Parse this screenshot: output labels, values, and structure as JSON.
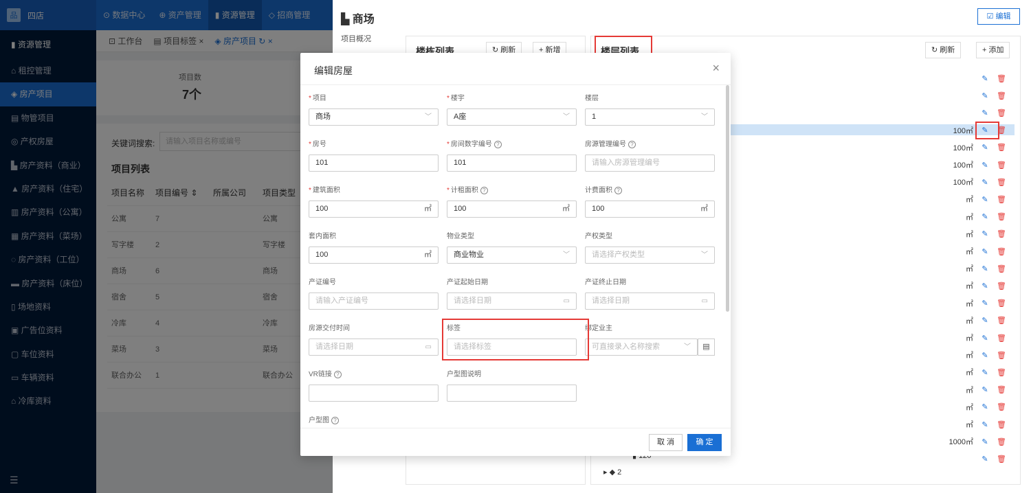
{
  "app": {
    "logo_text": "四店",
    "logo_glyph": "品"
  },
  "topnav": [
    {
      "label": "⊙ 数据中心"
    },
    {
      "label": "⊕ 资产管理"
    },
    {
      "label": "▮ 资源管理"
    },
    {
      "label": "◇ 招商管理"
    }
  ],
  "sidebar": {
    "items": [
      {
        "label": "▮ 资源管理"
      },
      {
        "label": "⌂ 租控管理"
      },
      {
        "label": "◈ 房产项目"
      },
      {
        "label": "▤ 物管项目"
      },
      {
        "label": "◎ 产权房屋"
      },
      {
        "label": "▙ 房产资料（商业）"
      },
      {
        "label": "▲ 房产资料（住宅）"
      },
      {
        "label": "▥ 房产资料（公寓）"
      },
      {
        "label": "▦ 房产资料（菜场）"
      },
      {
        "label": "◌ 房产资料（工位）"
      },
      {
        "label": "▬ 房产资料（床位）"
      },
      {
        "label": "▯ 场地资料"
      },
      {
        "label": "▣ 广告位资料"
      },
      {
        "label": "▢ 车位资料"
      },
      {
        "label": "▭ 车辆资料"
      },
      {
        "label": "⌂ 冷库资料"
      }
    ],
    "footer_icon": "☰"
  },
  "tabs": [
    {
      "label": "⊡ 工作台"
    },
    {
      "label": "▤ 项目标签 ×"
    },
    {
      "label": "◈ 房产项目 ↻ ×"
    }
  ],
  "stats": {
    "label": "项目数",
    "value": "7个"
  },
  "search": {
    "label": "关键词搜索:",
    "placeholder": "请输入项目名称或编号"
  },
  "project_list": {
    "title": "项目列表",
    "headers": [
      "项目名称",
      "项目编号  ⇕",
      "所属公司",
      "项目类型"
    ],
    "rows": [
      [
        "公寓",
        "7",
        "",
        "公寓"
      ],
      [
        "写字楼",
        "2",
        "",
        "写字楼"
      ],
      [
        "商场",
        "6",
        "",
        "商场"
      ],
      [
        "宿舍",
        "5",
        "",
        "宿舍"
      ],
      [
        "冷库",
        "4",
        "",
        "冷库"
      ],
      [
        "菜场",
        "3",
        "",
        "菜场"
      ],
      [
        "联合办公",
        "1",
        "",
        "联合办公"
      ]
    ]
  },
  "drawer": {
    "title": "▙ 商场",
    "edit_label": "☑ 编辑",
    "side_label": "项目概况",
    "building_panel": {
      "title": "楼栋列表",
      "refresh_label": "↻ 刷新",
      "add_label": "+ 新增"
    },
    "floor_panel": {
      "title": "楼层列表",
      "refresh_label": "↻ 刷新",
      "add_label": "+ 添加",
      "rows": [
        {
          "area": ""
        },
        {
          "area": ""
        },
        {
          "area": ""
        },
        {
          "area": "100㎡"
        },
        {
          "area": "100㎡"
        },
        {
          "area": "100㎡"
        },
        {
          "area": "100㎡"
        },
        {
          "area": "㎡"
        },
        {
          "area": "㎡"
        },
        {
          "area": "㎡"
        },
        {
          "area": "㎡"
        },
        {
          "area": "㎡"
        },
        {
          "area": "㎡"
        },
        {
          "area": "㎡"
        },
        {
          "area": "㎡"
        },
        {
          "area": "㎡"
        },
        {
          "area": "㎡"
        },
        {
          "area": "㎡"
        },
        {
          "area": "㎡"
        },
        {
          "area": "㎡"
        },
        {
          "area": "㎡"
        },
        {
          "area": "1000㎡"
        },
        {
          "area": ""
        }
      ],
      "tree_nodes": [
        {
          "label": "▮ 120"
        },
        {
          "label": "▸  ◆ 2"
        }
      ]
    }
  },
  "modal": {
    "title": "编辑房屋",
    "close": "×",
    "fields": {
      "project": {
        "label": "项目",
        "value": "商场"
      },
      "building": {
        "label": "楼宇",
        "value": "A座"
      },
      "floor": {
        "label": "楼层",
        "value": "1"
      },
      "room_no": {
        "label": "房号",
        "value": "101"
      },
      "room_digit_no": {
        "label": "房间数字编号",
        "value": "101"
      },
      "mgmt_no": {
        "label": "房源管理编号",
        "placeholder": "请输入房源管理编号"
      },
      "build_area": {
        "label": "建筑面积",
        "value": "100",
        "unit": "㎡"
      },
      "rent_area": {
        "label": "计租面积",
        "value": "100",
        "unit": "㎡"
      },
      "fee_area": {
        "label": "计费面积",
        "value": "100",
        "unit": "㎡"
      },
      "inner_area": {
        "label": "套内面积",
        "value": "100",
        "unit": "㎡"
      },
      "property_type": {
        "label": "物业类型",
        "value": "商业物业"
      },
      "title_type": {
        "label": "产权类型",
        "placeholder": "请选择产权类型"
      },
      "cert_no": {
        "label": "产证编号",
        "placeholder": "请输入产证编号"
      },
      "cert_start": {
        "label": "产证起始日期",
        "placeholder": "请选择日期"
      },
      "cert_end": {
        "label": "产证终止日期",
        "placeholder": "请选择日期"
      },
      "deliver_time": {
        "label": "房源交付时间",
        "placeholder": "请选择日期"
      },
      "tags": {
        "label": "标签",
        "placeholder": "请选择标签"
      },
      "owner": {
        "label": "绑定业主",
        "placeholder": "可直接录入名称搜索"
      },
      "vr_link": {
        "label": "VR链接",
        "value": ""
      },
      "floorplan_desc": {
        "label": "户型图说明",
        "value": ""
      },
      "floorplan": {
        "label": "户型图"
      }
    },
    "cancel_label": "取 消",
    "ok_label": "确 定"
  },
  "colors": {
    "primary": "#1a6fd4",
    "highlight": "#e53935",
    "sidebar": "#001a3a"
  }
}
